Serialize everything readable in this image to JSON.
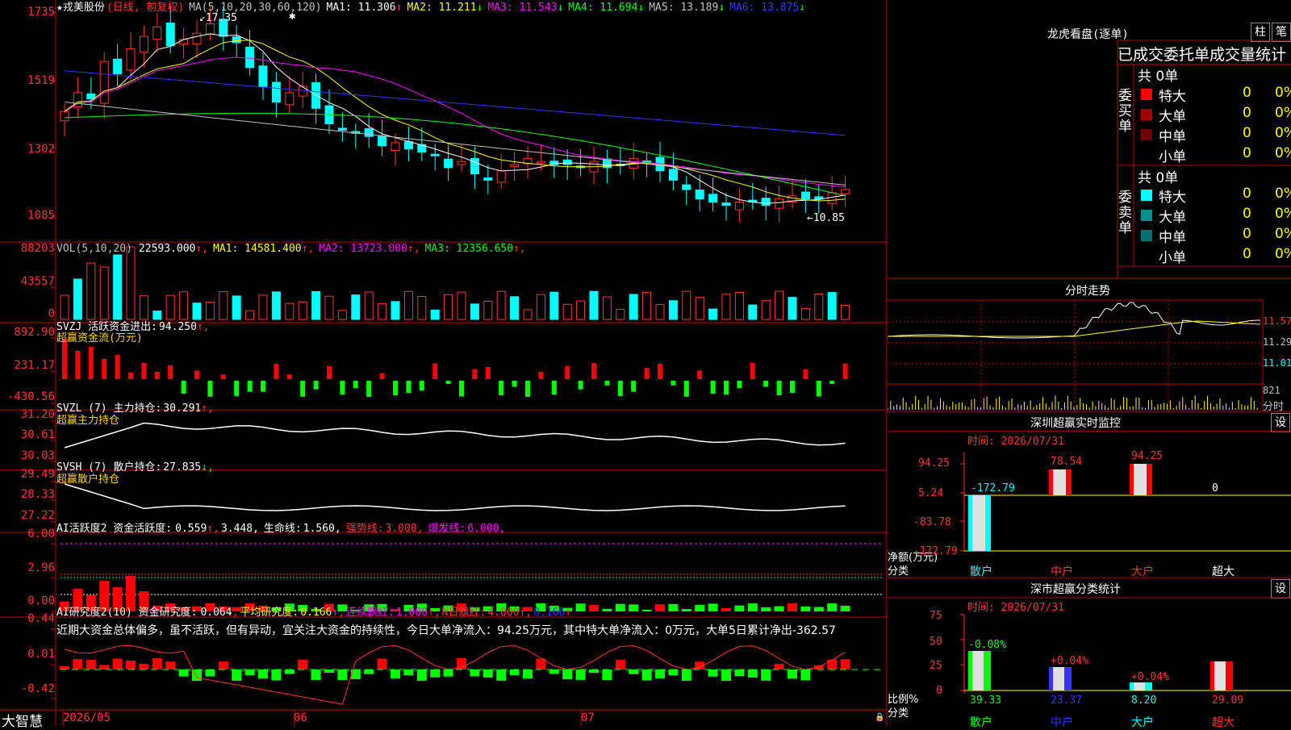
{
  "stock": {
    "name": "戎美股份",
    "mode": "(日线, 前复权)",
    "ma_label": "MA(5,10,20,30,60,120)",
    "ma": [
      {
        "label": "MA1:",
        "value": "11.306",
        "arrow": "↑",
        "color": "#ffffff"
      },
      {
        "label": "MA2:",
        "value": "11.211",
        "arrow": "↓",
        "color": "#ffff00"
      },
      {
        "label": "MA3:",
        "value": "11.543",
        "arrow": "↓",
        "color": "#ff00ff"
      },
      {
        "label": "MA4:",
        "value": "11.694",
        "arrow": "↓",
        "color": "#00ff00"
      },
      {
        "label": "MA5:",
        "value": "13.189",
        "arrow": "↓",
        "color": "#c0c0c0"
      },
      {
        "label": "MA6:",
        "value": "13.875",
        "arrow": "↓",
        "color": "#3333ff"
      }
    ],
    "high_marker": "17.35",
    "low_marker": "←10.85",
    "price_axis": [
      "1735",
      "1519",
      "1302",
      "1085"
    ]
  },
  "vol": {
    "label": "VOL(5,10,20)",
    "value": "22593.000",
    "ma": [
      {
        "label": "MA1:",
        "value": "14581.400",
        "color": "#ffff00"
      },
      {
        "label": "MA2:",
        "value": "13723.000",
        "color": "#ff00ff"
      },
      {
        "label": "MA3:",
        "value": "12356.650",
        "color": "#00ff00"
      }
    ],
    "axis": [
      "88203",
      "43557",
      "0"
    ]
  },
  "svzj": {
    "label": "SVZJ  活跃资金进出:",
    "value": "94.250",
    "subtitle": "超赢资金流(万元)",
    "axis": [
      "892.90",
      "231.17",
      "-430.56"
    ]
  },
  "svzl": {
    "label": "SVZL (7) 主力持仓:",
    "value": "30.291",
    "subtitle": "超赢主力持仓",
    "axis": [
      "31.20",
      "30.61",
      "30.03"
    ]
  },
  "svsh": {
    "label": "SVSH (7) 散户持仓:",
    "value": "27.835",
    "subtitle": "超赢散户持仓",
    "axis": [
      "29.49",
      "28.33",
      "27.22"
    ]
  },
  "ai_active": {
    "label": "AI活跃度2 资金活跃度:",
    "value1": "0.559",
    "value2": "3.448,",
    "life_label": "生命线:",
    "life_value": "1.560,",
    "strong_label": "强势线:",
    "strong_value": "3.000,",
    "burst_label": "爆发线:",
    "burst_value": "6.000,",
    "axis": [
      "6.00",
      "2.96",
      "0.00"
    ]
  },
  "ai_research": {
    "label": "AI研究度2(10) 资金研究度:",
    "value": "0.064",
    "avg_label": "平均研究度:",
    "avg_value": "0.166",
    "cont_label": "连续飘红:",
    "cont_value": "1.000",
    "n_label": "N日飘红:",
    "n_value": "4.000",
    "last_value": "0.166",
    "comment": "近期大资金总体偏多，虽不活跃，但有异动，宜关注大资金的持续性，今日大单净流入：94.25万元，其中特大单净流入：0万元，大单5日累计净出-362.57",
    "axis": [
      "0.44",
      "0.01",
      "-0.42"
    ]
  },
  "date_axis": {
    "brand": "大智慧",
    "labels": [
      "2026/05",
      "06",
      "07"
    ]
  },
  "right": {
    "dragon_title": "龙虎看盘(逐单)",
    "btn_a": "柱",
    "btn_b": "笔",
    "stats_title": "已成交委托单成交量统计",
    "buy_label": "委买单",
    "sell_label": "委卖单",
    "buy_total": "共 0单",
    "sell_total": "共 0单",
    "buy_rows": [
      {
        "label": "特大",
        "count": "0",
        "pct": "0%",
        "color": "#ff0000"
      },
      {
        "label": "大单",
        "count": "0",
        "pct": "0%",
        "color": "#a00000"
      },
      {
        "label": "中单",
        "count": "0",
        "pct": "0%",
        "color": "#700000"
      },
      {
        "label": "小单",
        "count": "0",
        "pct": "0%",
        "color": ""
      }
    ],
    "sell_rows": [
      {
        "label": "特大",
        "count": "0",
        "pct": "0%",
        "color": "#00ffff"
      },
      {
        "label": "大单",
        "count": "0",
        "pct": "0%",
        "color": "#009090"
      },
      {
        "label": "中单",
        "count": "0",
        "pct": "0%",
        "color": "#007070"
      },
      {
        "label": "小单",
        "count": "0",
        "pct": "0%",
        "color": ""
      }
    ],
    "intraday_title": "分时走势",
    "intraday_axis": [
      "11.57",
      "11.29",
      "11.01",
      "821",
      "分时"
    ],
    "monitor_title": "深圳超赢实时监控",
    "monitor_btn": "设",
    "monitor_time": "时间: 2026/07/31",
    "monitor_axis": [
      "94.25",
      "5.24",
      "-83.78",
      "-172.79"
    ],
    "monitor_values": [
      "-172.79",
      "78.54",
      "94.25",
      "0"
    ],
    "monitor_ylabel": "净额(万元)",
    "monitor_xlabel": "分类",
    "categories": [
      "散户",
      "中户",
      "大户",
      "超大"
    ],
    "class_title": "深市超赢分类统计",
    "class_btn": "设",
    "class_time": "时间: 2026/07/31",
    "class_axis": [
      "75",
      "50",
      "25",
      "0"
    ],
    "class_pct": [
      "-0.08%",
      "+0.04%",
      "+0.04%",
      ""
    ],
    "class_values": [
      "39.33",
      "23.37",
      "8.20",
      "29.09"
    ],
    "class_ylabel": "比例%",
    "class_xlabel": "分类"
  }
}
